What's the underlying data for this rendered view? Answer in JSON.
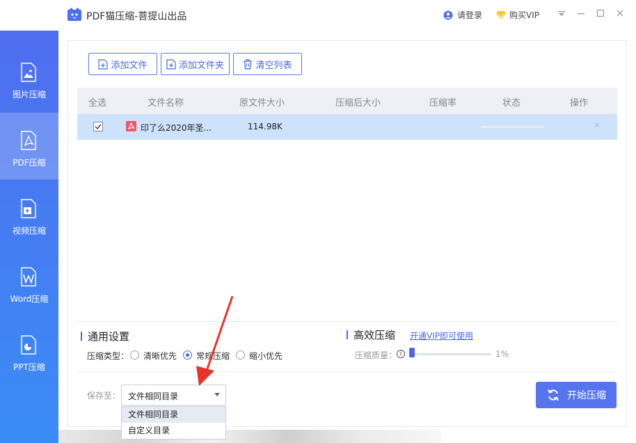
{
  "app": {
    "title": "PDF猫压缩-菩提山出品",
    "login_label": "请登录",
    "buy_vip_label": "购买VIP",
    "menu_icon": "dropdown-menu-icon",
    "minimize_icon": "minimize-icon",
    "maximize_icon": "maximize-icon",
    "close_icon": "close-icon"
  },
  "sidebar": {
    "items": [
      {
        "label": "图片压缩",
        "icon": "image-file-icon",
        "active": false
      },
      {
        "label": "PDF压缩",
        "icon": "pdf-file-icon",
        "active": true
      },
      {
        "label": "视频压缩",
        "icon": "video-file-icon",
        "active": false
      },
      {
        "label": "Word压缩",
        "icon": "word-file-icon",
        "active": false
      },
      {
        "label": "PPT压缩",
        "icon": "ppt-file-icon",
        "active": false
      }
    ]
  },
  "toolbar": {
    "add_file": "添加文件",
    "add_folder": "添加文件夹",
    "clear_list": "清空列表"
  },
  "table": {
    "headers": [
      "全选",
      "文件名称",
      "原文件大小",
      "压缩后大小",
      "压缩率",
      "状态",
      "操作"
    ],
    "rows": [
      {
        "checked": true,
        "name": "印了么2020年圣...",
        "original_size": "114.98K",
        "compressed_size": "",
        "ratio": "",
        "status": "",
        "action_icon": "close-icon"
      }
    ]
  },
  "settings": {
    "general_title": "通用设置",
    "type_label": "压缩类型：",
    "options": [
      {
        "label": "清晰优先",
        "checked": false
      },
      {
        "label": "常规压缩",
        "checked": true
      },
      {
        "label": "缩小优先",
        "checked": false
      }
    ],
    "efficient_title": "高效压缩",
    "vip_link": "开通VIP即可使用",
    "quality_label": "压缩质量：",
    "quality_value": "1%"
  },
  "save": {
    "label": "保存至：",
    "selected": "文件相同目录",
    "options": [
      "文件相同目录",
      "自定义目录"
    ]
  },
  "start_button": "开始压缩",
  "colors": {
    "accent": "#4a68e4",
    "sidebar_top": "#4f6ef0",
    "sidebar_bottom": "#3a8cf5",
    "row_selected": "#cfe2fb",
    "arrow": "#e8332a"
  }
}
